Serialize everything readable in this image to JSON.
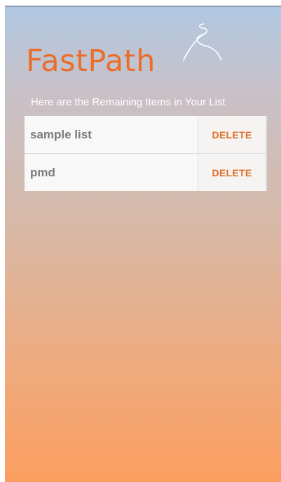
{
  "app": {
    "title": "FastPath",
    "logo_icon": "winding-path-icon"
  },
  "header": {
    "subtitle": "Here are the Remaining Items in Your List"
  },
  "list": {
    "items": [
      {
        "label": "sample list",
        "action": "DELETE"
      },
      {
        "label": "pmd",
        "action": "DELETE"
      }
    ]
  },
  "colors": {
    "accent": "#ea6e2a",
    "gradient_top": "#b0c8e3",
    "gradient_bottom": "#fb9e5f"
  }
}
